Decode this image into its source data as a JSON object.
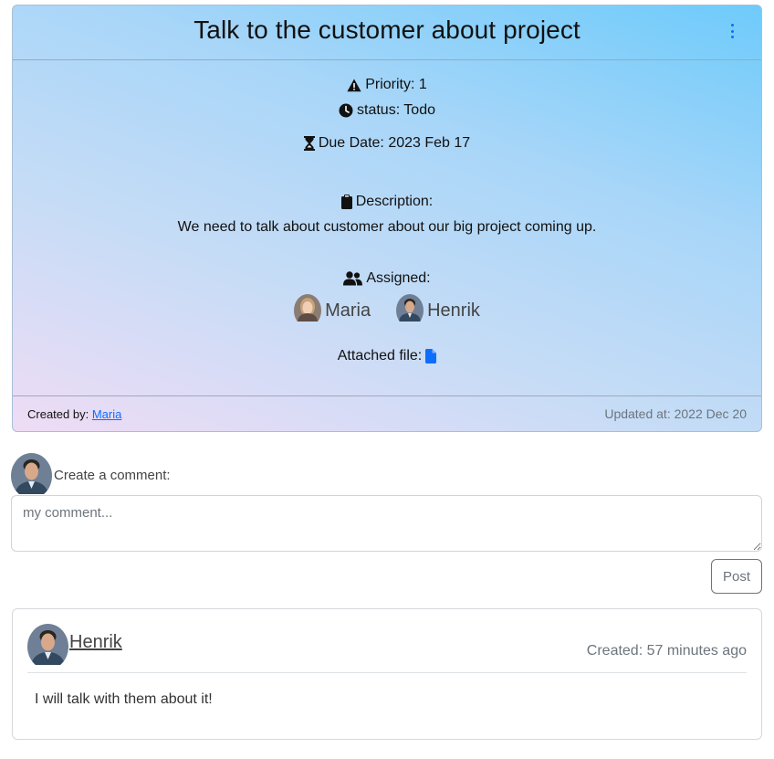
{
  "task": {
    "title": "Talk to the customer about project",
    "priority": "Priority: 1",
    "status": "status: Todo",
    "due_date": "Due Date: 2023 Feb 17",
    "description_label": "Description:",
    "description": "We need to talk about customer about our big project coming up.",
    "assigned_label": "Assigned:",
    "assignees": [
      "Maria",
      "Henrik"
    ],
    "attached_label": "Attached file:",
    "created_by_label": "Created by:",
    "created_by": "Maria",
    "updated": "Updated at: 2022 Dec 20"
  },
  "comment_form": {
    "label": "Create a comment:",
    "placeholder": "my comment...",
    "post_label": "Post"
  },
  "comments": [
    {
      "author": "Henrik",
      "created": "Created: 57 minutes ago",
      "text": "I will talk with them about it!"
    }
  ],
  "colors": {
    "accent": "#0d6efd",
    "header_gradient_start": "#6ecbfb",
    "header_gradient_end": "#efdcf5"
  }
}
